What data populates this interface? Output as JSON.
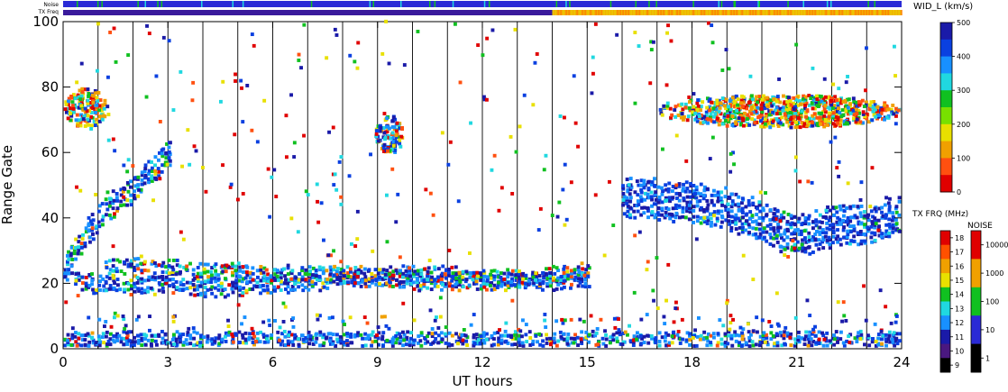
{
  "chart_data": {
    "type": "scatter",
    "title": "",
    "xlabel": "UT hours",
    "ylabel": "Range Gate",
    "xlim": [
      0,
      24
    ],
    "ylim": [
      0,
      100
    ],
    "x_ticks": [
      "0",
      "3",
      "6",
      "9",
      "12",
      "15",
      "18",
      "21",
      "24"
    ],
    "y_ticks": [
      "0",
      "20",
      "40",
      "60",
      "80",
      "100"
    ],
    "x_tick_values": [
      0,
      3,
      6,
      9,
      12,
      15,
      18,
      21,
      24
    ],
    "y_tick_values": [
      0,
      20,
      40,
      60,
      80,
      100
    ],
    "grid": false,
    "scan_boundaries_ut": [
      1,
      2,
      3,
      4,
      5,
      6,
      7,
      8,
      9,
      10,
      11,
      12,
      13,
      14,
      15,
      16,
      17,
      18,
      19,
      20,
      21,
      22,
      23
    ],
    "top_strips": {
      "noise_label": "Noise",
      "txfreq_label": "TX Freq",
      "noise_color": "#2a2ad6",
      "txfreq_color_before_14ut": "#3a1a9c",
      "txfreq_color_after_14ut": "#f2b000",
      "txfreq_change_ut": 14
    },
    "colorbars": {
      "width": {
        "label": "WID_L (km/s)",
        "ticks": [
          "500",
          "400",
          "300",
          "200",
          "100",
          "0"
        ],
        "tick_values": [
          500,
          400,
          300,
          200,
          100,
          0
        ],
        "range": [
          0,
          500
        ],
        "colors": [
          "#1a1aa8",
          "#0a40e0",
          "#1890ff",
          "#20d8e0",
          "#10c020",
          "#78e000",
          "#e8e000",
          "#f0a000",
          "#ff5010",
          "#e00000"
        ]
      },
      "txfreq": {
        "label": "TX FRQ (MHz)",
        "ticks": [
          "18",
          "17",
          "16",
          "15",
          "14",
          "13",
          "12",
          "11",
          "10",
          "9"
        ],
        "colors": [
          "#e00000",
          "#ff5000",
          "#f0a000",
          "#e8e000",
          "#10c020",
          "#20d8e0",
          "#1890ff",
          "#1a1aa8",
          "#4a1880",
          "#000000"
        ]
      },
      "noise": {
        "label": "NOISE",
        "ticks": [
          "10000",
          "1000",
          "100",
          "10",
          "1"
        ],
        "colors": [
          "#e00000",
          "#f0a000",
          "#10c020",
          "#2a2ad6",
          "#000000"
        ]
      }
    },
    "series": [
      {
        "type": "band",
        "points": [
          [
            0.0,
            24
          ],
          [
            0.3,
            30
          ],
          [
            0.6,
            34
          ],
          [
            0.9,
            38
          ],
          [
            1.2,
            42
          ],
          [
            1.6,
            45
          ],
          [
            2.0,
            48
          ],
          [
            2.4,
            52
          ],
          [
            2.8,
            57
          ],
          [
            3.1,
            61
          ]
        ],
        "halfwidth": 3,
        "color_weights": [
          8,
          3,
          1
        ]
      },
      {
        "type": "band",
        "points": [
          [
            0.0,
            23
          ],
          [
            0.2,
            22
          ],
          [
            0.5,
            20
          ],
          [
            1.2,
            19
          ],
          [
            2.0,
            19
          ],
          [
            3.0,
            19
          ],
          [
            4.0,
            18
          ],
          [
            5.0,
            18
          ],
          [
            6.0,
            19
          ],
          [
            7.0,
            20
          ],
          [
            8.0,
            21
          ],
          [
            9.0,
            21
          ],
          [
            10.0,
            20
          ],
          [
            11.0,
            20
          ],
          [
            12.0,
            20
          ],
          [
            13.0,
            20
          ],
          [
            14.0,
            20
          ],
          [
            15.0,
            21
          ]
        ],
        "halfwidth": 1.5,
        "color_weights": [
          9,
          2,
          1
        ]
      },
      {
        "type": "band",
        "points": [
          [
            1.2,
            24
          ],
          [
            2.0,
            25
          ],
          [
            3.0,
            24
          ],
          [
            4.0,
            23
          ],
          [
            5.0,
            23
          ],
          [
            6.0,
            22
          ],
          [
            7.0,
            22
          ],
          [
            8.0,
            22
          ],
          [
            9.0,
            22
          ],
          [
            10.0,
            22
          ],
          [
            11.0,
            22
          ],
          [
            12.0,
            21
          ],
          [
            13.0,
            21
          ],
          [
            14.0,
            22
          ],
          [
            15.0,
            23
          ]
        ],
        "halfwidth": 1.3,
        "color_weights": [
          6,
          3,
          2
        ]
      },
      {
        "type": "band",
        "points": [
          [
            0.0,
            2
          ],
          [
            2.0,
            1
          ],
          [
            4.0,
            2
          ],
          [
            6.0,
            2
          ],
          [
            8.0,
            2
          ],
          [
            10.0,
            2
          ],
          [
            12.0,
            2
          ],
          [
            14.0,
            2
          ],
          [
            16.0,
            2
          ],
          [
            18.0,
            2
          ],
          [
            20.0,
            2
          ],
          [
            22.0,
            2
          ],
          [
            24.0,
            2
          ]
        ],
        "halfwidth": 2,
        "color_weights": [
          10,
          2,
          1
        ]
      },
      {
        "type": "band",
        "points": [
          [
            16.0,
            46
          ],
          [
            17.0,
            45
          ],
          [
            18.0,
            44
          ],
          [
            19.0,
            42
          ],
          [
            19.5,
            40
          ],
          [
            20.0,
            38
          ],
          [
            20.5,
            36
          ],
          [
            21.0,
            34
          ],
          [
            21.5,
            35
          ],
          [
            22.0,
            37
          ],
          [
            22.5,
            38
          ],
          [
            23.0,
            37
          ],
          [
            23.5,
            39
          ],
          [
            24.0,
            41
          ]
        ],
        "halfwidth": 5,
        "color_weights": [
          12,
          1,
          0
        ]
      },
      {
        "type": "cluster",
        "center": [
          9.3,
          65
        ],
        "radius": [
          0.4,
          6
        ],
        "color_weights": [
          4,
          2,
          3
        ]
      },
      {
        "type": "cluster",
        "center": [
          0.6,
          73
        ],
        "radius": [
          0.6,
          6
        ],
        "color_weights": [
          2,
          3,
          6
        ]
      },
      {
        "type": "cluster",
        "center": [
          20.5,
          72
        ],
        "radius": [
          3.5,
          5
        ],
        "color_weights": [
          2,
          3,
          6
        ]
      }
    ]
  }
}
